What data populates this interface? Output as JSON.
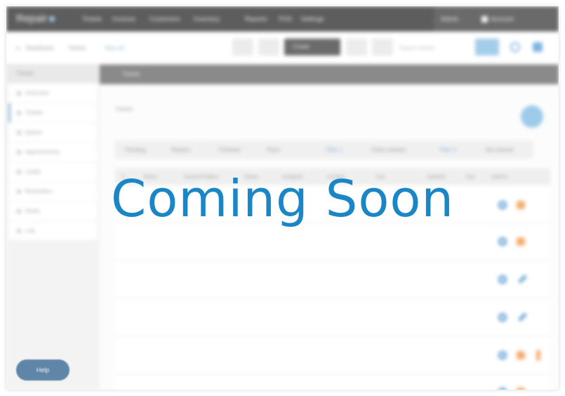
{
  "app": {
    "logo_text": "Repair",
    "nav": [
      "Tickets",
      "Invoices",
      "Customers",
      "Inventory",
      "Reports",
      "POS",
      "Settings"
    ]
  },
  "topnav_right": {
    "user": "Admin",
    "account": "Account"
  },
  "toolbar": {
    "crumbs": [
      "Dashboard",
      "Tickets",
      "View all"
    ],
    "primary_button": "Create",
    "search_placeholder": "Search tickets"
  },
  "sidebar": {
    "header": "Tickets",
    "items": [
      "Overview",
      "Tickets",
      "Queue",
      "Appointments",
      "Leads",
      "Reminders",
      "Notes",
      "Log"
    ]
  },
  "main": {
    "header_title": "Tickets",
    "subtitle": "Tickets",
    "filters": [
      "Pending",
      "Repairs",
      "Finished",
      "Parts"
    ],
    "filter_links": [
      "Filter 1",
      "Filter 2"
    ],
    "filter_link_labels": [
      "Parts needed",
      "Not started"
    ],
    "columns": [
      "#",
      "Status",
      "Device/Problem",
      "Status",
      "Assigned",
      "Created",
      "Due",
      "Updated",
      "Due",
      "Actions"
    ],
    "rows": [
      {
        "id": "",
        "type": "",
        "device": "",
        "status": "",
        "created": "",
        "due": "",
        "updated": ""
      },
      {
        "id": "",
        "type": "",
        "device": "",
        "status": "",
        "created": "",
        "due": "",
        "updated": ""
      },
      {
        "id": "",
        "type": "",
        "device": "",
        "status": "",
        "created": "",
        "due": "",
        "updated": ""
      },
      {
        "id": "",
        "type": "",
        "device": "",
        "status": "",
        "created": "",
        "due": "",
        "updated": ""
      },
      {
        "id": "",
        "type": "",
        "device": "",
        "status": "",
        "created": "",
        "due": "",
        "updated": ""
      },
      {
        "id": "",
        "type": "",
        "device": "",
        "status": "",
        "created": "",
        "due": "",
        "updated": ""
      }
    ]
  },
  "help": {
    "label": "Help"
  },
  "overlay": {
    "text": "Coming Soon"
  },
  "colors": {
    "accent": "#1a86c6",
    "nav_bg": "#5d5d5d",
    "link": "#7fb1db",
    "warning": "#f2a25e"
  }
}
